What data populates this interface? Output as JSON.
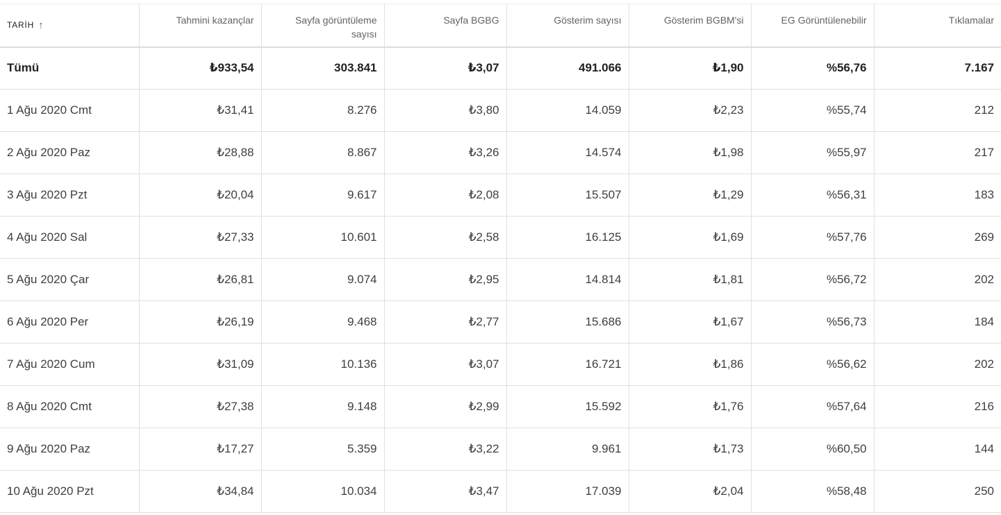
{
  "table": {
    "headers": {
      "date": "TARİH",
      "date_sort_icon": "arrow-up-icon",
      "earnings": "Tahmini kazançlar",
      "page_views_line1": "Sayfa görüntüleme",
      "page_views_line2": "sayısı",
      "page_rpm": "Sayfa BGBG",
      "impressions": "Gösterim sayısı",
      "impression_rpm": "Gösterim BGBM'si",
      "viewable": "EG Görüntülenebilir",
      "clicks": "Tıklamalar"
    },
    "total": {
      "date": "Tümü",
      "earnings": "₺933,54",
      "page_views": "303.841",
      "page_rpm": "₺3,07",
      "impressions": "491.066",
      "impression_rpm": "₺1,90",
      "viewable": "%56,76",
      "clicks": "7.167"
    },
    "rows": [
      {
        "date": "1 Ağu 2020 Cmt",
        "earnings": "₺31,41",
        "page_views": "8.276",
        "page_rpm": "₺3,80",
        "impressions": "14.059",
        "impression_rpm": "₺2,23",
        "viewable": "%55,74",
        "clicks": "212"
      },
      {
        "date": "2 Ağu 2020 Paz",
        "earnings": "₺28,88",
        "page_views": "8.867",
        "page_rpm": "₺3,26",
        "impressions": "14.574",
        "impression_rpm": "₺1,98",
        "viewable": "%55,97",
        "clicks": "217"
      },
      {
        "date": "3 Ağu 2020 Pzt",
        "earnings": "₺20,04",
        "page_views": "9.617",
        "page_rpm": "₺2,08",
        "impressions": "15.507",
        "impression_rpm": "₺1,29",
        "viewable": "%56,31",
        "clicks": "183"
      },
      {
        "date": "4 Ağu 2020 Sal",
        "earnings": "₺27,33",
        "page_views": "10.601",
        "page_rpm": "₺2,58",
        "impressions": "16.125",
        "impression_rpm": "₺1,69",
        "viewable": "%57,76",
        "clicks": "269"
      },
      {
        "date": "5 Ağu 2020 Çar",
        "earnings": "₺26,81",
        "page_views": "9.074",
        "page_rpm": "₺2,95",
        "impressions": "14.814",
        "impression_rpm": "₺1,81",
        "viewable": "%56,72",
        "clicks": "202"
      },
      {
        "date": "6 Ağu 2020 Per",
        "earnings": "₺26,19",
        "page_views": "9.468",
        "page_rpm": "₺2,77",
        "impressions": "15.686",
        "impression_rpm": "₺1,67",
        "viewable": "%56,73",
        "clicks": "184"
      },
      {
        "date": "7 Ağu 2020 Cum",
        "earnings": "₺31,09",
        "page_views": "10.136",
        "page_rpm": "₺3,07",
        "impressions": "16.721",
        "impression_rpm": "₺1,86",
        "viewable": "%56,62",
        "clicks": "202"
      },
      {
        "date": "8 Ağu 2020 Cmt",
        "earnings": "₺27,38",
        "page_views": "9.148",
        "page_rpm": "₺2,99",
        "impressions": "15.592",
        "impression_rpm": "₺1,76",
        "viewable": "%57,64",
        "clicks": "216"
      },
      {
        "date": "9 Ağu 2020 Paz",
        "earnings": "₺17,27",
        "page_views": "5.359",
        "page_rpm": "₺3,22",
        "impressions": "9.961",
        "impression_rpm": "₺1,73",
        "viewable": "%60,50",
        "clicks": "144"
      },
      {
        "date": "10 Ağu 2020 Pzt",
        "earnings": "₺34,84",
        "page_views": "10.034",
        "page_rpm": "₺3,47",
        "impressions": "17.039",
        "impression_rpm": "₺2,04",
        "viewable": "%58,48",
        "clicks": "250"
      }
    ]
  }
}
